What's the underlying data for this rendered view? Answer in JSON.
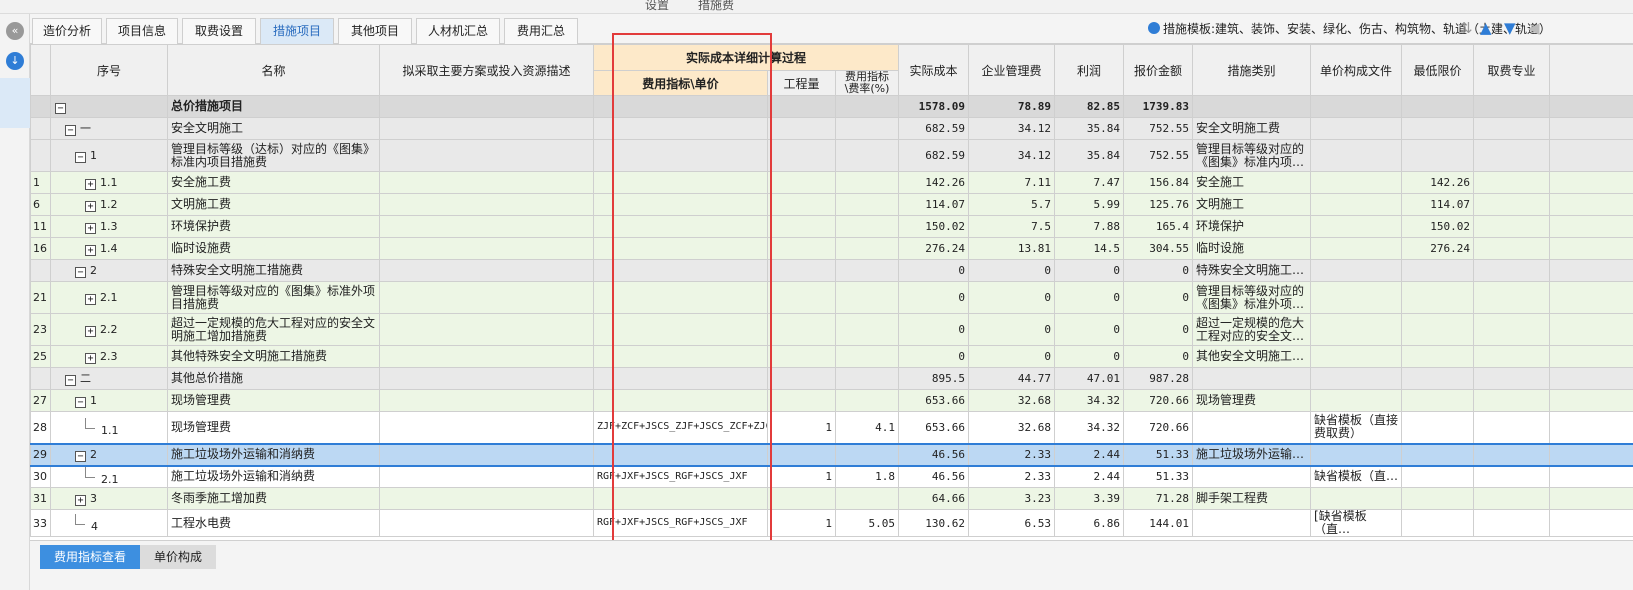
{
  "top_strip": {
    "left_label": "设置",
    "right_label": "措施费"
  },
  "tabs": [
    {
      "label": "造价分析",
      "active": false
    },
    {
      "label": "项目信息",
      "active": false
    },
    {
      "label": "取费设置",
      "active": false
    },
    {
      "label": "措施项目",
      "active": true
    },
    {
      "label": "其他项目",
      "active": false
    },
    {
      "label": "人材机汇总",
      "active": false
    },
    {
      "label": "费用汇总",
      "active": false
    }
  ],
  "template_label": "措施模板:建筑、装饰、安装、绿化、伤古、构筑物、轨道（土建、轨道）",
  "columns": {
    "seq": "序号",
    "name": "名称",
    "plan": "拟采取主要方案或投入资源描述",
    "group": "实际成本详细计算过程",
    "indicator": "费用指标\\单价",
    "qty": "工程量",
    "rate": "费用指标\\费率(%)",
    "actual": "实际成本",
    "mgmt": "企业管理费",
    "profit": "利润",
    "quote": "报价金额",
    "category": "措施类别",
    "unit_file": "单价构成文件",
    "min_price": "最低限价",
    "specialty": "取费专业"
  },
  "rows": [
    {
      "type": "lvl0",
      "row": "",
      "box": "−",
      "seq": "",
      "name": "总价措施项目",
      "indicator": "",
      "qty": "",
      "rate": "",
      "actual": "1578.09",
      "mgmt": "78.89",
      "profit": "82.85",
      "quote": "1739.83",
      "category": "",
      "unit_file": "",
      "min_price": ""
    },
    {
      "type": "grp",
      "row": "",
      "box": "−",
      "seq": "一",
      "name": "安全文明施工",
      "indicator": "",
      "qty": "",
      "rate": "",
      "actual": "682.59",
      "mgmt": "34.12",
      "profit": "35.84",
      "quote": "752.55",
      "category": "安全文明施工费",
      "unit_file": "",
      "min_price": ""
    },
    {
      "type": "grp tall",
      "row": "",
      "box": "−",
      "seq": "1",
      "name": "管理目标等级（达标）对应的《图集》标准内项目措施费",
      "indicator": "",
      "qty": "",
      "rate": "",
      "actual": "682.59",
      "mgmt": "34.12",
      "profit": "35.84",
      "quote": "752.55",
      "category": "管理目标等级对应的《图集》标准内项…",
      "unit_file": "",
      "min_price": ""
    },
    {
      "type": "item",
      "row": "1",
      "box": "+",
      "seq": "1.1",
      "name": "安全施工费",
      "indicator": "",
      "qty": "",
      "rate": "",
      "actual": "142.26",
      "mgmt": "7.11",
      "profit": "7.47",
      "quote": "156.84",
      "category": "安全施工",
      "unit_file": "",
      "min_price": "142.26"
    },
    {
      "type": "item",
      "row": "6",
      "box": "+",
      "seq": "1.2",
      "name": "文明施工费",
      "indicator": "",
      "qty": "",
      "rate": "",
      "actual": "114.07",
      "mgmt": "5.7",
      "profit": "5.99",
      "quote": "125.76",
      "category": "文明施工",
      "unit_file": "",
      "min_price": "114.07"
    },
    {
      "type": "item",
      "row": "11",
      "box": "+",
      "seq": "1.3",
      "name": "环境保护费",
      "indicator": "",
      "qty": "",
      "rate": "",
      "actual": "150.02",
      "mgmt": "7.5",
      "profit": "7.88",
      "quote": "165.4",
      "category": "环境保护",
      "unit_file": "",
      "min_price": "150.02"
    },
    {
      "type": "item",
      "row": "16",
      "box": "+",
      "seq": "1.4",
      "name": "临时设施费",
      "indicator": "",
      "qty": "",
      "rate": "",
      "actual": "276.24",
      "mgmt": "13.81",
      "profit": "14.5",
      "quote": "304.55",
      "category": "临时设施",
      "unit_file": "",
      "min_price": "276.24"
    },
    {
      "type": "grp",
      "row": "",
      "box": "−",
      "seq": "2",
      "name": "特殊安全文明施工措施费",
      "indicator": "",
      "qty": "",
      "rate": "",
      "actual": "0",
      "mgmt": "0",
      "profit": "0",
      "quote": "0",
      "category": "特殊安全文明施工…",
      "unit_file": "",
      "min_price": ""
    },
    {
      "type": "item tall",
      "row": "21",
      "box": "+",
      "seq": "2.1",
      "name": "管理目标等级对应的《图集》标准外项目措施费",
      "indicator": "",
      "qty": "",
      "rate": "",
      "actual": "0",
      "mgmt": "0",
      "profit": "0",
      "quote": "0",
      "category": "管理目标等级对应的《图集》标准外项…",
      "unit_file": "",
      "min_price": ""
    },
    {
      "type": "item tall",
      "row": "23",
      "box": "+",
      "seq": "2.2",
      "name": "超过一定规模的危大工程对应的安全文明施工增加措施费",
      "indicator": "",
      "qty": "",
      "rate": "",
      "actual": "0",
      "mgmt": "0",
      "profit": "0",
      "quote": "0",
      "category": "超过一定规模的危大工程对应的安全文…",
      "unit_file": "",
      "min_price": ""
    },
    {
      "type": "item",
      "row": "25",
      "box": "+",
      "seq": "2.3",
      "name": "其他特殊安全文明施工措施费",
      "indicator": "",
      "qty": "",
      "rate": "",
      "actual": "0",
      "mgmt": "0",
      "profit": "0",
      "quote": "0",
      "category": "其他安全文明施工…",
      "unit_file": "",
      "min_price": ""
    },
    {
      "type": "grp",
      "row": "",
      "box": "−",
      "seq": "二",
      "name": "其他总价措施",
      "indicator": "",
      "qty": "",
      "rate": "",
      "actual": "895.5",
      "mgmt": "44.77",
      "profit": "47.01",
      "quote": "987.28",
      "category": "",
      "unit_file": "",
      "min_price": ""
    },
    {
      "type": "item",
      "row": "27",
      "box": "−",
      "seq": "1",
      "name": "现场管理费",
      "indicator": "",
      "qty": "",
      "rate": "",
      "actual": "653.66",
      "mgmt": "32.68",
      "profit": "34.32",
      "quote": "720.66",
      "category": "现场管理费",
      "unit_file": "",
      "min_price": ""
    },
    {
      "type": "plain tall",
      "row": "28",
      "box": "",
      "seq": "1.1",
      "name": "现场管理费",
      "indicator": "ZJF+ZCF+JSCS_ZJF+JSCS_ZCF+ZJCSJXCGL",
      "qty": "1",
      "rate": "4.1",
      "actual": "653.66",
      "mgmt": "32.68",
      "profit": "34.32",
      "quote": "720.66",
      "category": "",
      "unit_file": "缺省模板（直接费取费）",
      "min_price": ""
    },
    {
      "type": "sel",
      "row": "29",
      "box": "−",
      "seq": "2",
      "name": "施工垃圾场外运输和消纳费",
      "indicator": "",
      "qty": "",
      "rate": "",
      "actual": "46.56",
      "mgmt": "2.33",
      "profit": "2.44",
      "quote": "51.33",
      "category": "施工垃圾场外运输…",
      "unit_file": "",
      "min_price": ""
    },
    {
      "type": "plain",
      "row": "30",
      "box": "",
      "seq": "2.1",
      "name": "施工垃圾场外运输和消纳费",
      "indicator": "RGF+JXF+JSCS_RGF+JSCS_JXF",
      "qty": "1",
      "rate": "1.8",
      "actual": "46.56",
      "mgmt": "2.33",
      "profit": "2.44",
      "quote": "51.33",
      "category": "",
      "unit_file": "缺省模板（直…",
      "min_price": ""
    },
    {
      "type": "item",
      "row": "31",
      "box": "+",
      "seq": "3",
      "name": "冬雨季施工增加费",
      "indicator": "",
      "qty": "",
      "rate": "",
      "actual": "64.66",
      "mgmt": "3.23",
      "profit": "3.39",
      "quote": "71.28",
      "category": "脚手架工程费",
      "unit_file": "",
      "min_price": ""
    },
    {
      "type": "plain",
      "row": "33",
      "box": "",
      "seq": "4",
      "name": "工程水电费",
      "indicator": "RGF+JXF+JSCS_RGF+JSCS_JXF",
      "qty": "1",
      "rate": "5.05",
      "actual": "130.62",
      "mgmt": "6.53",
      "profit": "6.86",
      "quote": "144.01",
      "category": "",
      "unit_file": "[缺省模板（直…",
      "min_price": ""
    }
  ],
  "bottom_tabs": [
    {
      "label": "费用指标查看",
      "active": true
    },
    {
      "label": "单价构成",
      "active": false
    }
  ],
  "colors": {
    "accent": "#2f7dd6",
    "highlight_frame": "#e23b3b",
    "selected_row": "#bcd8f3",
    "item_row": "#edf6e5"
  }
}
